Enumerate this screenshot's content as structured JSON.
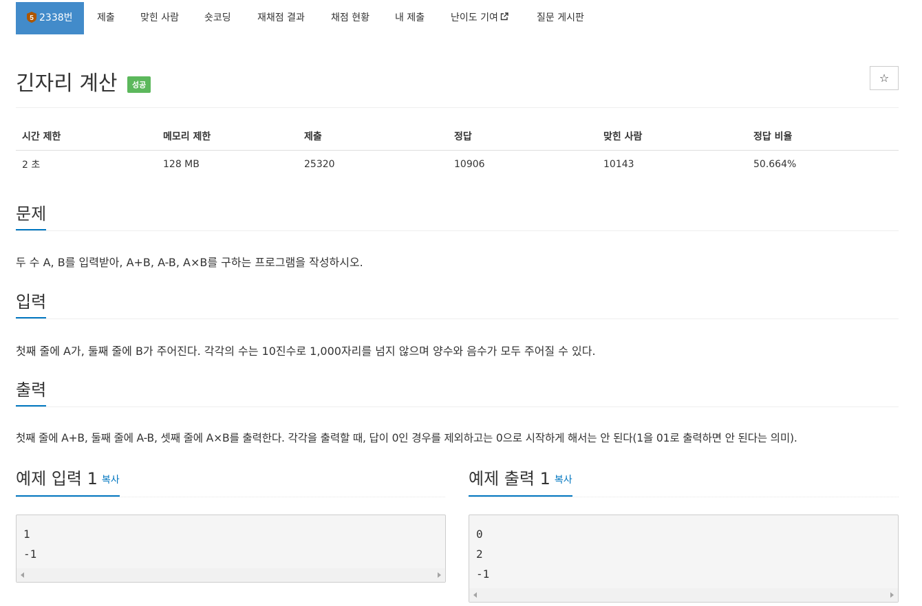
{
  "nav": {
    "problem_number": "2338번",
    "items": [
      {
        "label": "제출"
      },
      {
        "label": "맞힌 사람"
      },
      {
        "label": "숏코딩"
      },
      {
        "label": "재채점 결과"
      },
      {
        "label": "채점 현황"
      },
      {
        "label": "내 제출"
      },
      {
        "label": "난이도 기여"
      },
      {
        "label": "질문 게시판"
      }
    ],
    "tier_badge": "5",
    "tier_color": "#ad5600"
  },
  "problem": {
    "title": "긴자리 계산",
    "status_label": "성공",
    "star": "☆"
  },
  "info": {
    "headers": [
      "시간 제한",
      "메모리 제한",
      "제출",
      "정답",
      "맞힌 사람",
      "정답 비율"
    ],
    "values": [
      "2 초",
      "128 MB",
      "25320",
      "10906",
      "10143",
      "50.664%"
    ]
  },
  "sections": {
    "description_title": "문제",
    "description": "두 수 A, B를 입력받아, A+B, A-B, A×B를 구하는 프로그램을 작성하시오.",
    "input_title": "입력",
    "input": "첫째 줄에 A가, 둘째 줄에 B가 주어진다. 각각의 수는 10진수로 1,000자리를 넘지 않으며 양수와 음수가 모두 주어질 수 있다.",
    "output_title": "출력",
    "output": "첫째 줄에 A+B, 둘째 줄에 A-B, 셋째 줄에 A×B를 출력한다. 각각을 출력할 때, 답이 0인 경우를 제외하고는 0으로 시작하게 해서는 안 된다(1을 01로 출력하면 안 된다는 의미)."
  },
  "samples": {
    "input_title": "예제 입력 1",
    "output_title": "예제 출력 1",
    "copy_label": "복사",
    "input_lines": [
      "1",
      "-1"
    ],
    "output_lines": [
      "0",
      "2",
      "-1"
    ]
  },
  "colors": {
    "accent": "#0076c0",
    "nav_active": "#428bca",
    "success": "#5cb85c"
  }
}
